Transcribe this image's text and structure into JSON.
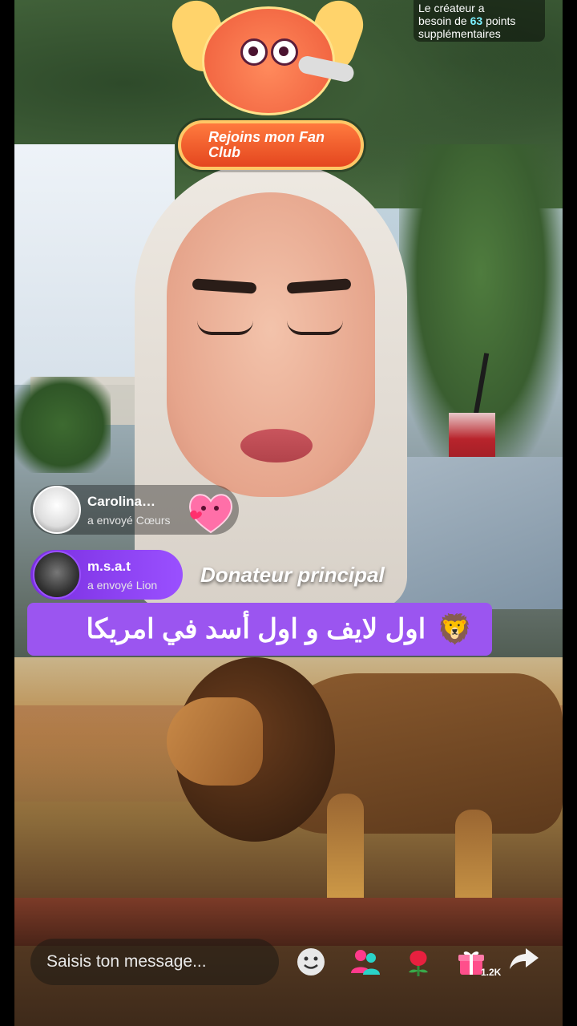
{
  "top_info": {
    "line1": "Le créateur a",
    "line2_prefix": "besoin de ",
    "points": "63",
    "line2_suffix": " points",
    "line3": "supplémentaires"
  },
  "fan_club": {
    "label": "Rejoins mon Fan Club"
  },
  "gifts": [
    {
      "name": "Carolina…",
      "action": "a envoyé",
      "gift": "Cœurs"
    },
    {
      "name": "m.s.a.t",
      "action": "a envoyé",
      "gift": "Lion"
    }
  ],
  "top_donor_label": "Donateur principal",
  "banner": {
    "text": "اول لايف و اول أسد في امريكا",
    "emoji": "🦁"
  },
  "composer": {
    "placeholder": "Saisis ton message..."
  },
  "actions": {
    "emoji_icon": "smiley-icon",
    "guests_icon": "guests-icon",
    "rose_icon": "rose-icon",
    "gift_icon": "gift-icon",
    "share_icon": "share-icon",
    "share_count": "1.2K"
  },
  "colors": {
    "banner": "#9b55f0",
    "fanclub": "#e4461f",
    "points": "#7bf0ff"
  }
}
